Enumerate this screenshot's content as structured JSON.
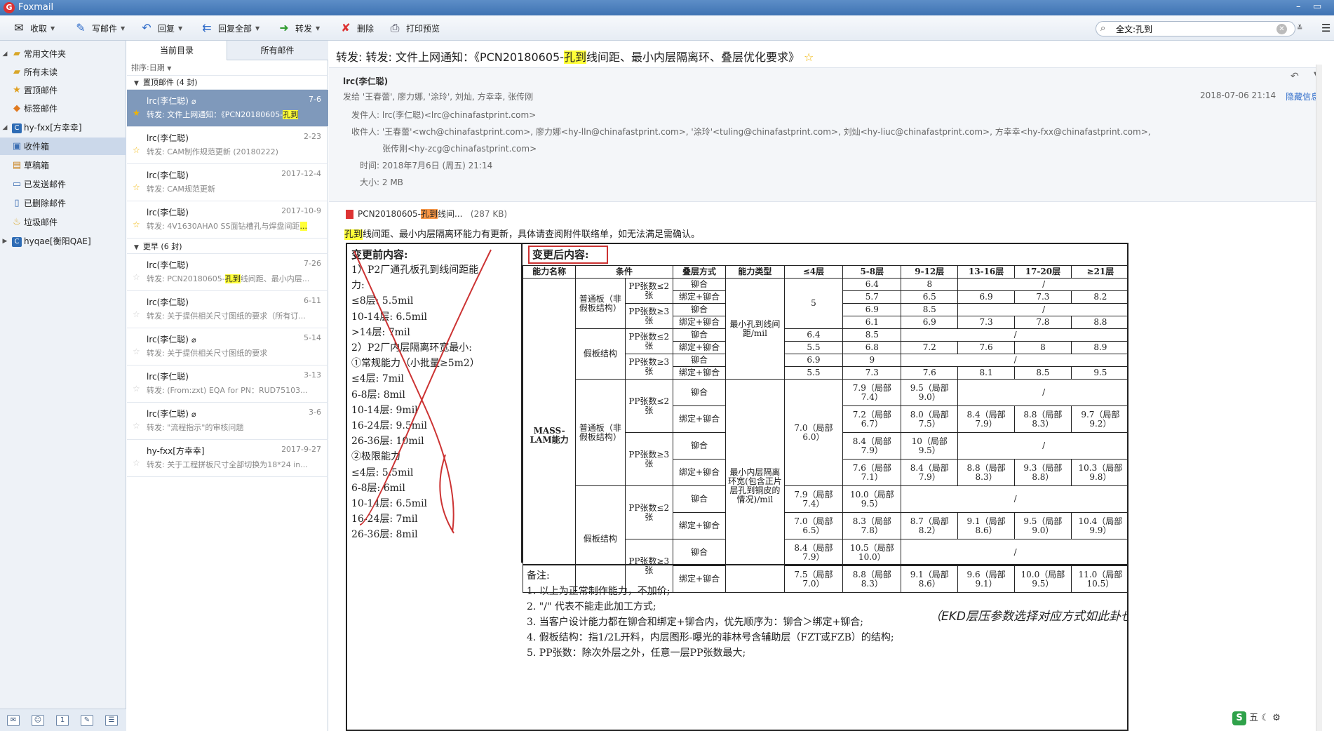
{
  "app": {
    "title": "Foxmail",
    "logo": "foxmail-logo"
  },
  "toolbar": {
    "receive": "收取",
    "compose": "写邮件",
    "reply": "回复",
    "reply_all": "回复全部",
    "forward": "转发",
    "delete": "删除",
    "print_preview": "打印预览",
    "search_value": "全文:孔到"
  },
  "folders": {
    "common": "常用文件夹",
    "all_unread": "所有未读",
    "pinned": "置顶邮件",
    "tagged": "标签邮件",
    "account1": "hy-fxx[方幸幸]",
    "inbox": "收件箱",
    "drafts": "草稿箱",
    "sent": "已发送邮件",
    "deleted": "已删除邮件",
    "junk": "垃圾邮件",
    "account2": "hyqae[衡阳QAE]"
  },
  "list": {
    "tab_current": "当前目录",
    "tab_all": "所有邮件",
    "sort": "排序:日期",
    "group_pinned": "置顶邮件 (4 封)",
    "group_earlier": "更早 (6 封)",
    "items": [
      {
        "from": "lrc(李仁聪)",
        "date": "7-6",
        "subj_a": "转发: 文件上网通知：《PCN20180605-",
        "subj_hl": "孔到",
        "subj_b": ""
      },
      {
        "from": "lrc(李仁聪)",
        "date": "2-23",
        "subj_a": "转发: CAM制作规范更新 (20180222)",
        "subj_hl": "",
        "subj_b": ""
      },
      {
        "from": "lrc(李仁聪)",
        "date": "2017-12-4",
        "subj_a": "转发: CAM规范更新",
        "subj_hl": "",
        "subj_b": ""
      },
      {
        "from": "lrc(李仁聪)",
        "date": "2017-10-9",
        "subj_a": "转发: 4V1630AHA0  SS面钻槽孔与焊盘间距",
        "subj_hl": "...",
        "subj_b": ""
      },
      {
        "from": "lrc(李仁聪)",
        "date": "7-26",
        "subj_a": "转发: PCN20180605-",
        "subj_hl": "孔到",
        "subj_b": "线间距、最小内层..."
      },
      {
        "from": "lrc(李仁聪)",
        "date": "6-11",
        "subj_a": "转发: 关于提供相关尺寸图纸的要求（所有订...",
        "subj_hl": "",
        "subj_b": ""
      },
      {
        "from": "lrc(李仁聪)",
        "date": "5-14",
        "subj_a": "转发: 关于提供相关尺寸图纸的要求",
        "subj_hl": "",
        "subj_b": ""
      },
      {
        "from": "lrc(李仁聪)",
        "date": "3-13",
        "subj_a": "转发: (From:zxt) EQA for  PN：RUD75103...",
        "subj_hl": "",
        "subj_b": ""
      },
      {
        "from": "lrc(李仁聪)",
        "date": "3-6",
        "subj_a": "转发: \"流程指示\"的审核问题",
        "subj_hl": "",
        "subj_b": ""
      },
      {
        "from": "hy-fxx[方幸幸]",
        "date": "2017-9-27",
        "subj_a": "转发: 关于工程拼板尺寸全部切换为18*24 in...",
        "subj_hl": "",
        "subj_b": ""
      }
    ]
  },
  "mail": {
    "subject_a": "转发: 转发: 文件上网通知：《PCN20180605-",
    "subject_hl": "孔到",
    "subject_b": "线间距、最小内层隔离环、叠层优化要求》",
    "sender_short": "lrc(李仁聪)",
    "send_to_line": "发给 '王春蕾', 廖力娜, '涂玲', 刘灿, 方幸幸, 张传刚",
    "datetime": "2018-07-06 21:14",
    "hide_info": "隐藏信息",
    "from_label": "发件人:",
    "from_value": "lrc(李仁聪)<lrc@chinafastprint.com>",
    "to_label": "收件人:",
    "to_value": "'王春蕾'<wch@chinafastprint.com>,  廖力娜<hy-lln@chinafastprint.com>,  '涂玲'<tuling@chinafastprint.com>,  刘灿<hy-liuc@chinafastprint.com>,  方幸幸<hy-fxx@chinafastprint.com>,",
    "to_value2": "张传刚<hy-zcg@chinafastprint.com>",
    "time_label": "时间:",
    "time_value": "2018年7月6日 (周五) 21:14",
    "size_label": "大小:",
    "size_value": "2 MB",
    "attachment_a": "PCN20180605-",
    "attachment_hl": "孔到",
    "attachment_b": "线间...",
    "attachment_size": "(287 KB)",
    "body_hl": "孔到",
    "body": "线间距、最小内层隔离环能力有更新，具体请查阅附件联络单，如无法满足需确认。"
  },
  "doc": {
    "left_title": "变更前内容:",
    "left_lines": [
      "1）P2厂通孔板孔到线间距能",
      "力:",
      "≤8层: 5.5mil",
      "10-14层: 6.5mil",
      ">14层: 7mil",
      "2）P2厂内层隔离环宽最小:",
      "①常规能力（小批量≥5m2）",
      "≤4层: 7mil",
      "6-8层: 8mil",
      "10-14层: 9mil",
      "16-24层: 9.5mil",
      "26-36层: 10mil",
      "②极限能力",
      "≤4层: 5.5mil",
      "6-8层: 6mil",
      "10-14层: 6.5mil",
      "16-24层: 7mil",
      "26-36层: 8mil"
    ],
    "right_title": "变更后内容:",
    "headers": [
      "能力名称",
      "条件",
      "叠层方式",
      "能力类型",
      "≤4层",
      "5-8层",
      "9-12层",
      "13-16层",
      "17-20层",
      "≥21层"
    ],
    "rowlabel": "MASS-LAM能力",
    "normal": "普通板（非假板结构）",
    "fake": "假板结构",
    "pp_le2": "PP张数≤2张",
    "pp_ge3": "PP张数≥3张",
    "rivet": "铆合",
    "bind_rivet": "绑定+铆合",
    "type1": "最小孔到线间距/mil",
    "type2": "最小内层隔离环宽(包含正片层孔到铜皮的情况)/mil",
    "slash": "/",
    "r1": [
      "6.4",
      "8"
    ],
    "r2": [
      "5.7",
      "6.5",
      "6.9",
      "7.3",
      "8.2"
    ],
    "r3": [
      "6.9",
      "8.5"
    ],
    "r4": [
      "6.1",
      "6.9",
      "7.3",
      "7.8",
      "8.8"
    ],
    "g1_le4": "5",
    "r5": [
      "6.4",
      "8.5"
    ],
    "r6": [
      "5.5",
      "6.8",
      "7.2",
      "7.6",
      "8",
      "8.9"
    ],
    "r7": [
      "6.9",
      "9"
    ],
    "r8": [
      "5.5",
      "7.3",
      "7.6",
      "8.1",
      "8.5",
      "9.5"
    ],
    "r9": [
      "7.9（局部7.4）",
      "9.5（局部9.0）"
    ],
    "r10": [
      "7.2（局部6.7）",
      "8.0（局部7.5）",
      "8.4（局部7.9）",
      "8.8（局部8.3）",
      "9.7（局部9.2）"
    ],
    "g2_le4": "7.0（局部6.0）",
    "r11": [
      "8.4（局部7.9）",
      "10（局部9.5）"
    ],
    "r12": [
      "7.6（局部7.1）",
      "8.4（局部7.9）",
      "8.8（局部8.3）",
      "9.3（局部8.8）",
      "10.3（局部9.8）"
    ],
    "r13": [
      "7.9（局部7.4）",
      "10.0（局部9.5）"
    ],
    "r14": [
      "7.0（局部6.5）",
      "8.3（局部7.8）",
      "8.7（局部8.2）",
      "9.1（局部8.6）",
      "9.5（局部9.0）",
      "10.4（局部9.9）"
    ],
    "r15": [
      "8.4（局部7.9）",
      "10.5（局部10.0）"
    ],
    "r16": [
      "7.5（局部7.0）",
      "8.8（局部8.3）",
      "9.1（局部8.6）",
      "9.6（局部9.1）",
      "10.0（局部9.5）",
      "11.0（局部10.5）"
    ],
    "notes_title": "备注:",
    "notes": [
      "1. 以上为正常制作能力，不加价;",
      "2. \"/\" 代表不能走此加工方式;",
      "3. 当客户设计能力都在铆合和绑定+铆合内，优先顺序为：铆合＞绑定+铆合;",
      "4. 假板结构：指1/2L开料，内层图形-曝光的菲林号含辅助层（FZT或FZB）的结构;",
      "5. PP张数：除次外层之外，任意一层PP张数最大;"
    ],
    "handwriting": "（EKD层压参数选择对应方式如此卦也需有其要求）"
  },
  "ime": {
    "label": "五"
  }
}
